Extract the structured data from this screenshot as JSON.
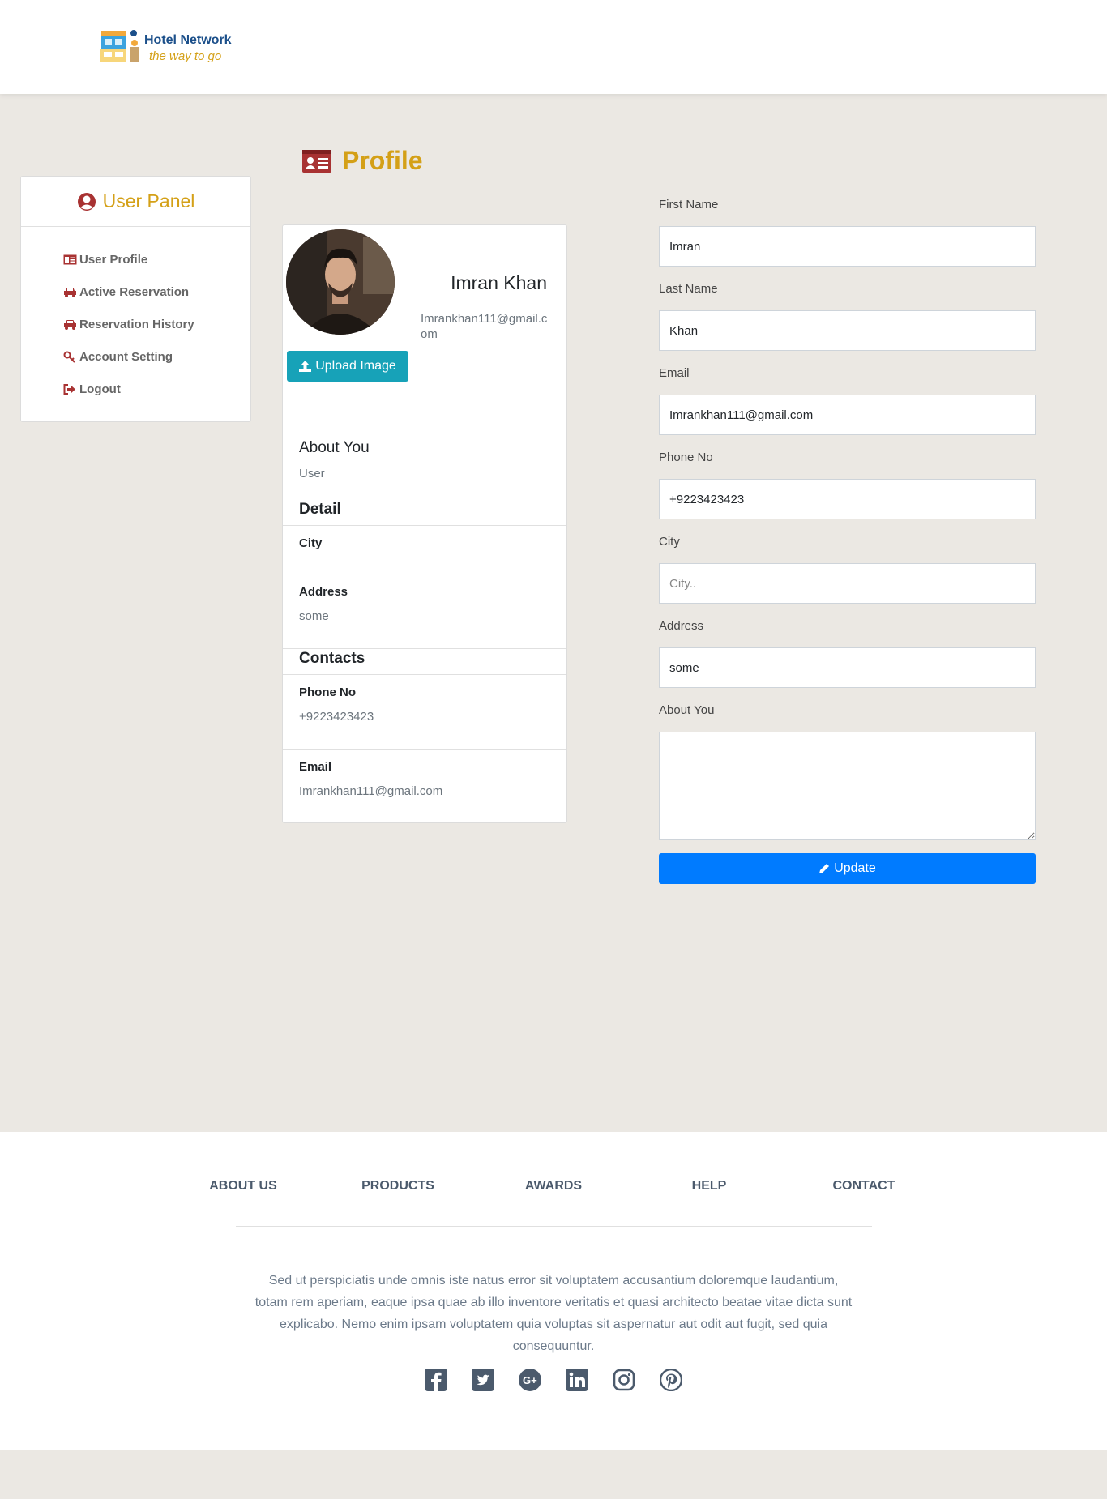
{
  "brand": {
    "name": "Hotel Network",
    "tagline": "the way to go"
  },
  "sidebar": {
    "title": "User Panel",
    "items": [
      {
        "label": "User Profile",
        "icon": "id-card-icon"
      },
      {
        "label": "Active Reservation",
        "icon": "car-icon"
      },
      {
        "label": "Reservation History",
        "icon": "car-icon"
      },
      {
        "label": "Account Setting",
        "icon": "key-icon"
      },
      {
        "label": "Logout",
        "icon": "sign-out-icon"
      }
    ]
  },
  "page": {
    "title": "Profile"
  },
  "profile_card": {
    "name": "Imran Khan",
    "email": "Imrankhan111@gmail.com",
    "upload_label": "Upload Image",
    "about_heading": "About You",
    "about_value": "User",
    "detail_heading": "Detail",
    "city_label": "City",
    "city_value": "",
    "address_label": "Address",
    "address_value": "some",
    "contacts_heading": "Contacts",
    "phone_label": "Phone No",
    "phone_value": "+9223423423",
    "email_label": "Email",
    "email_value": "Imrankhan111@gmail.com"
  },
  "form": {
    "first_name": {
      "label": "First Name",
      "value": "Imran"
    },
    "last_name": {
      "label": "Last Name",
      "value": "Khan"
    },
    "email": {
      "label": "Email",
      "value": "Imrankhan111@gmail.com"
    },
    "phone": {
      "label": "Phone No",
      "value": "+9223423423"
    },
    "city": {
      "label": "City",
      "value": "",
      "placeholder": "City.."
    },
    "address": {
      "label": "Address",
      "value": "some"
    },
    "about": {
      "label": "About You",
      "value": ""
    },
    "update_label": "Update"
  },
  "footer": {
    "links": [
      "ABOUT US",
      "PRODUCTS",
      "AWARDS",
      "HELP",
      "CONTACT"
    ],
    "text": "Sed ut perspiciatis unde omnis iste natus error sit voluptatem accusantium doloremque laudantium, totam rem aperiam, eaque ipsa quae ab illo inventore veritatis et quasi architecto beatae vitae dicta sunt explicabo. Nemo enim ipsam voluptatem quia voluptas sit aspernatur aut odit aut fugit, sed quia consequuntur.",
    "socials": [
      "facebook-icon",
      "twitter-icon",
      "google-plus-icon",
      "linkedin-icon",
      "instagram-icon",
      "pinterest-icon"
    ]
  },
  "colors": {
    "accent": "#d4a017",
    "icon_red": "#a83232",
    "teal": "#17a2b8",
    "primary": "#007bff",
    "page_bg": "#ebe8e3"
  }
}
